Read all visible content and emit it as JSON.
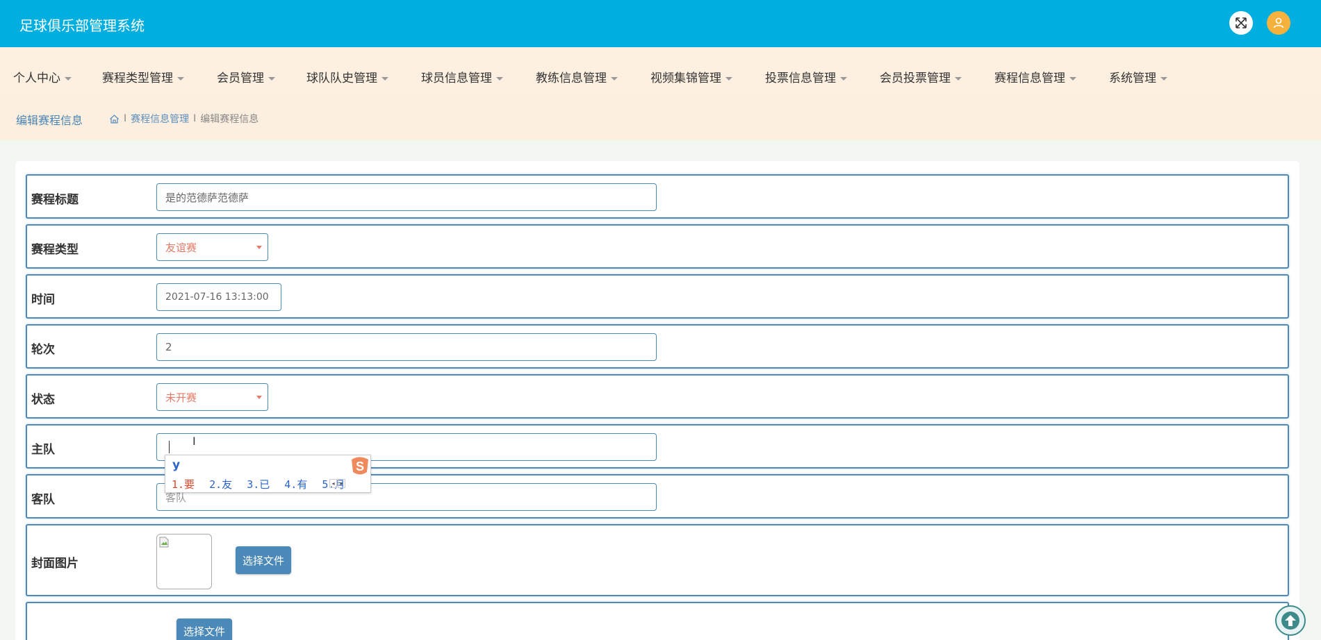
{
  "header": {
    "app_title": "足球俱乐部管理系统",
    "icons": [
      "fullscreen-icon",
      "user-avatar-icon"
    ],
    "accent_color": "#00afe0"
  },
  "nav": {
    "items": [
      {
        "label": "个人中心"
      },
      {
        "label": "赛程类型管理"
      },
      {
        "label": "会员管理"
      },
      {
        "label": "球队队史管理"
      },
      {
        "label": "球员信息管理"
      },
      {
        "label": "教练信息管理"
      },
      {
        "label": "视频集锦管理"
      },
      {
        "label": "投票信息管理"
      },
      {
        "label": "会员投票管理"
      },
      {
        "label": "赛程信息管理"
      },
      {
        "label": "系统管理"
      }
    ]
  },
  "breadcrumb": {
    "page_title": "编辑赛程信息",
    "home_icon": "home-icon",
    "separator": "I",
    "parent": "赛程信息管理",
    "current": "编辑赛程信息"
  },
  "form": {
    "title": {
      "label": "赛程标题",
      "value": "是的范德萨范德萨"
    },
    "type": {
      "label": "赛程类型",
      "value": "友谊赛"
    },
    "time": {
      "label": "时间",
      "value": "2021-07-16 13:13:00"
    },
    "round": {
      "label": "轮次",
      "value": "2"
    },
    "status": {
      "label": "状态",
      "value": "未开赛"
    },
    "home_team": {
      "label": "主队",
      "value": ""
    },
    "away_team": {
      "label": "客队",
      "placeholder": "客队"
    },
    "cover": {
      "label": "封面图片",
      "button": "选择文件"
    },
    "video": {
      "label": "",
      "button": "选择文件"
    }
  },
  "ime": {
    "input": "y",
    "candidates": [
      "1.要",
      "2.友",
      "3.已",
      "4.有",
      "5.月"
    ],
    "logo": "sogou-icon"
  }
}
